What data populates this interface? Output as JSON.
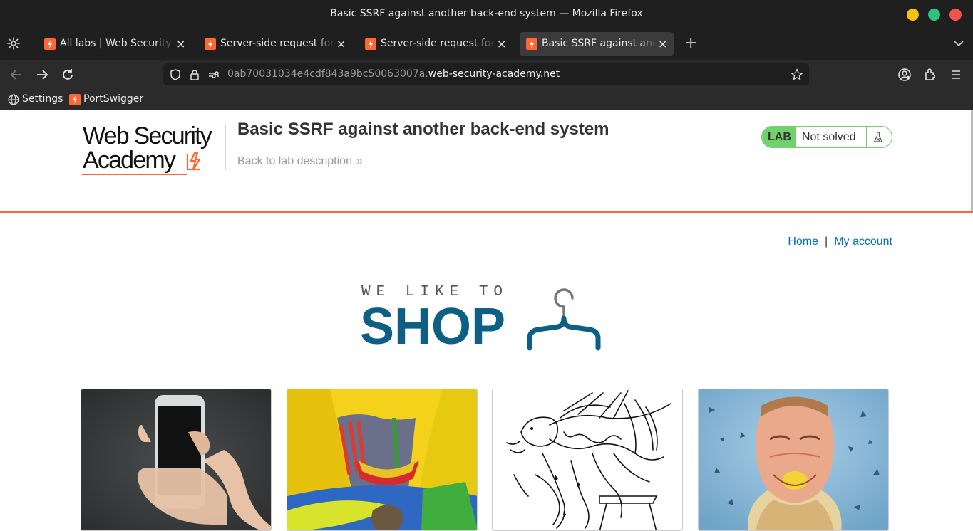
{
  "window": {
    "title": "Basic SSRF against another back-end system — Mozilla Firefox"
  },
  "tabs": [
    {
      "label": "All labs | Web Security Academy",
      "active": false
    },
    {
      "label": "Server-side request forgery",
      "active": false
    },
    {
      "label": "Server-side request forgery",
      "active": false
    },
    {
      "label": "Basic SSRF against another back-end system",
      "active": true
    }
  ],
  "tab_icons": {
    "settings": "gear-icon",
    "new_tab": "+",
    "close": "×"
  },
  "address_bar": {
    "subdomain": "0ab70031034e4cdf843a9bc50063007a.",
    "domain": "web-security-academy.net"
  },
  "bookmarks": [
    {
      "label": "Settings",
      "icon": "globe-icon"
    },
    {
      "label": "PortSwigger",
      "icon": "portswigger-icon"
    }
  ],
  "header": {
    "logo_line1": "Web Security",
    "logo_line2": "Academy",
    "lab_title": "Basic SSRF against another back-end system",
    "back_link": "Back to lab description",
    "back_chevron": "»"
  },
  "lab_status": {
    "badge": "LAB",
    "status": "Not solved"
  },
  "site_nav": {
    "home": "Home",
    "separator": "|",
    "my_account": "My account"
  },
  "shop_logo": {
    "tagline": "WE LIKE TO",
    "word": "SHOP"
  },
  "products": [
    {
      "image": "hand-holding-smartphone"
    },
    {
      "image": "inflatable-bouncy-castle"
    },
    {
      "image": "ink-sketch-man-on-stool"
    },
    {
      "image": "man-biting-lemon"
    }
  ],
  "colors": {
    "accent": "#ff6633",
    "link": "#0071bc",
    "shop_blue": "#0e5f86",
    "lab_green": "#70d16d"
  }
}
